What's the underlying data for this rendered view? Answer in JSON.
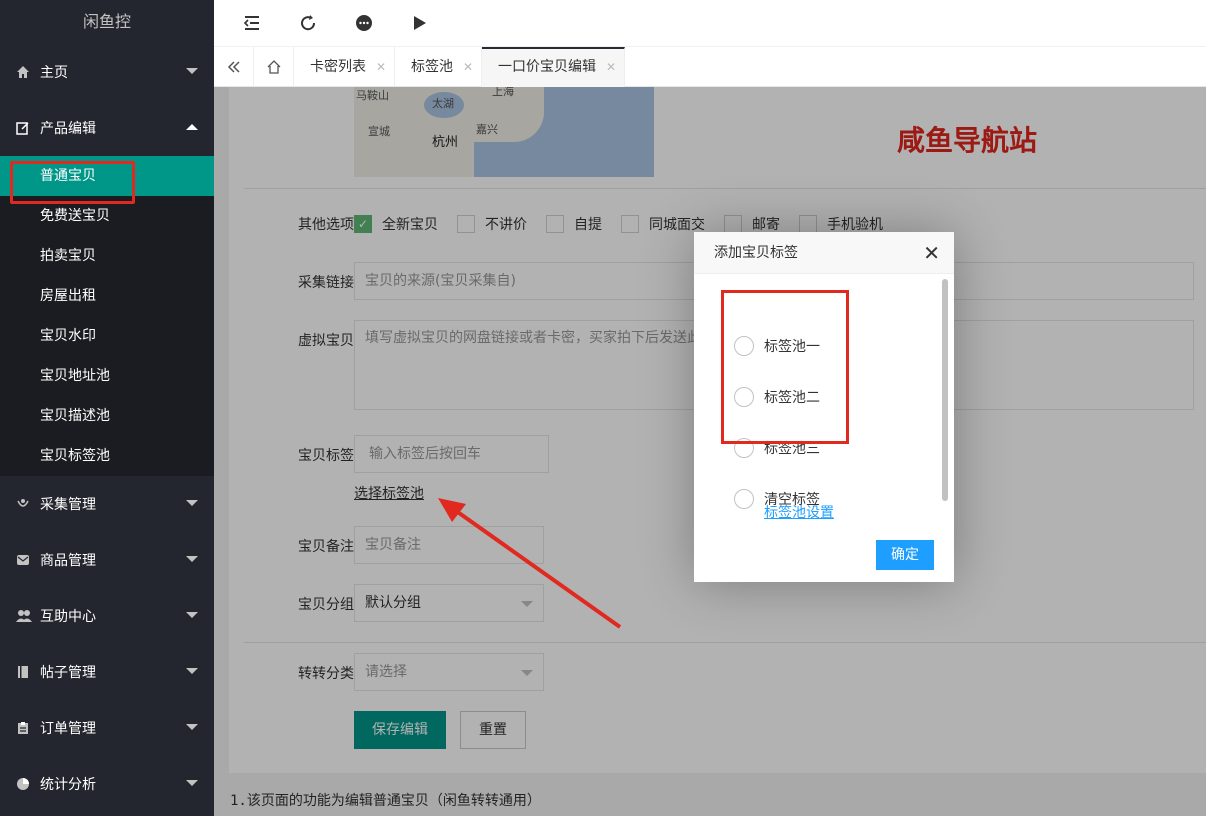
{
  "brand": "闲鱼控",
  "sidebar": {
    "top_items": [
      {
        "label": "主页",
        "icon": "home-icon"
      },
      {
        "label": "产品编辑",
        "icon": "edit-icon"
      }
    ],
    "sub_items": [
      "普通宝贝",
      "免费送宝贝",
      "拍卖宝贝",
      "房屋出租",
      "宝贝水印",
      "宝贝地址池",
      "宝贝描述池",
      "宝贝标签池"
    ],
    "bottom_items": [
      {
        "label": "采集管理",
        "icon": "collect-icon"
      },
      {
        "label": "商品管理",
        "icon": "mail-icon"
      },
      {
        "label": "互助中心",
        "icon": "users-icon"
      },
      {
        "label": "帖子管理",
        "icon": "book-icon"
      },
      {
        "label": "订单管理",
        "icon": "clipboard-icon"
      },
      {
        "label": "统计分析",
        "icon": "pie-chart-icon"
      }
    ]
  },
  "tabs": [
    "卡密列表",
    "标签池",
    "一口价宝贝编辑"
  ],
  "map": {
    "labels": [
      "马鞍山",
      "太湖",
      "上海",
      "宣城",
      "嘉兴",
      "杭州"
    ]
  },
  "watermark": "咸鱼导航站",
  "form": {
    "other_options_label": "其他选项",
    "options": [
      {
        "label": "全新宝贝",
        "checked": true
      },
      {
        "label": "不讲价",
        "checked": false
      },
      {
        "label": "自提",
        "checked": false
      },
      {
        "label": "同城面交",
        "checked": false
      },
      {
        "label": "邮寄",
        "checked": false
      },
      {
        "label": "手机验机",
        "checked": false
      }
    ],
    "collect_link_label": "采集链接",
    "collect_link_placeholder": "宝贝的来源(宝贝采集自)",
    "virtual_label": "虚拟宝贝",
    "virtual_placeholder": "填写虚拟宝贝的网盘链接或者卡密，买家拍下后发送此",
    "tag_label": "宝贝标签",
    "tag_placeholder": "输入标签后按回车",
    "choose_pool_link": "选择标签池",
    "remark_label": "宝贝备注",
    "remark_placeholder": "宝贝备注",
    "group_label": "宝贝分组",
    "group_value": "默认分组",
    "zz_label": "转转分类",
    "zz_placeholder": "请选择",
    "save_button": "保存编辑",
    "reset_button": "重置"
  },
  "notes": [
    "1.该页面的功能为编辑普通宝贝（闲鱼转转通用）"
  ],
  "dialog": {
    "title": "添加宝贝标签",
    "options": [
      "标签池一",
      "标签池二",
      "标签池三",
      "清空标签"
    ],
    "settings_link": "标签池设置",
    "ok_button": "确定"
  },
  "colors": {
    "accent": "#009688",
    "highlight_red": "#e02a1f",
    "dialog_blue": "#1e9fff"
  }
}
